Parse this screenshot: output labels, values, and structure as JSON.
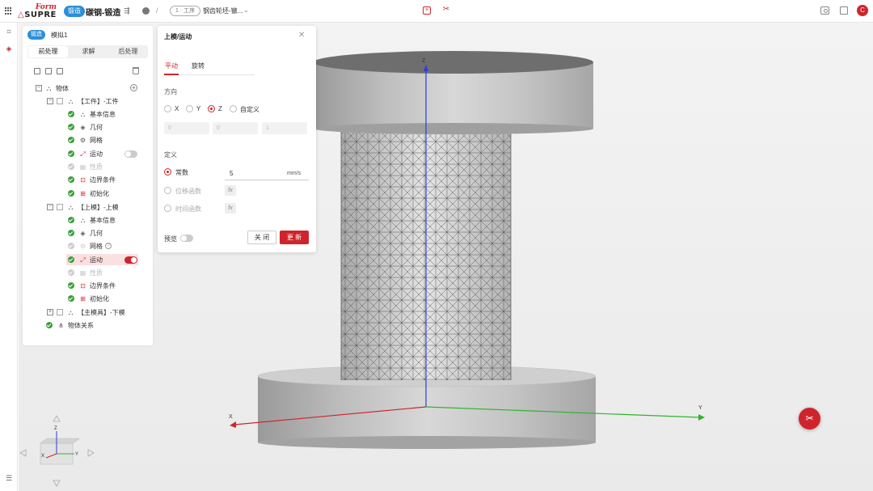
{
  "topbar": {
    "logo_top": "Form",
    "logo_bottom": "SUPRE",
    "logo_prefix": "△",
    "category_tag": "锻造",
    "doc_title": "碳钢-锻造",
    "step_pill": "1 · 工序",
    "step_name": "钢齿轮坯-镦...",
    "avatar_letter": "C"
  },
  "panel": {
    "category_tag": "锻造",
    "model_name": "模拟1",
    "tabs": [
      "前处理",
      "求解",
      "后处理"
    ],
    "active_tab": 0,
    "tree": [
      {
        "label": "物体"
      },
      {
        "label": "【工件】-工件"
      },
      {
        "label": "基本信息"
      },
      {
        "label": "几何"
      },
      {
        "label": "网格"
      },
      {
        "label": "运动"
      },
      {
        "label": "性质"
      },
      {
        "label": "边界条件"
      },
      {
        "label": "初始化"
      },
      {
        "label": "【上模】-上模"
      },
      {
        "label": "基本信息"
      },
      {
        "label": "几何"
      },
      {
        "label": "网格"
      },
      {
        "label": "运动"
      },
      {
        "label": "性质"
      },
      {
        "label": "边界条件"
      },
      {
        "label": "初始化"
      },
      {
        "label": "【主模具】-下模"
      },
      {
        "label": "物体关系"
      }
    ]
  },
  "dialog": {
    "title": "上模/运动",
    "tabs": [
      "平动",
      "旋转"
    ],
    "active_tab": 0,
    "direction_label": "方向",
    "directions": [
      "X",
      "Y",
      "Z",
      "自定义"
    ],
    "selected_direction": "Z",
    "vector": [
      "0",
      "0",
      "1"
    ],
    "definition_label": "定义",
    "definitions": [
      "常数",
      "位移函数",
      "时间函数"
    ],
    "selected_definition": "常数",
    "constant_value": "5",
    "unit": "mm/s",
    "fx_label": "fx",
    "preview_label": "预览",
    "preview_on": false,
    "close_label": "关 闭",
    "update_label": "更 新"
  },
  "viewport": {
    "axis_x": "X",
    "axis_y": "Y",
    "axis_z": "Z"
  },
  "colors": {
    "brand_red": "#d0242c",
    "accent_blue": "#2a8fd8",
    "ok_green": "#3aa03a"
  }
}
